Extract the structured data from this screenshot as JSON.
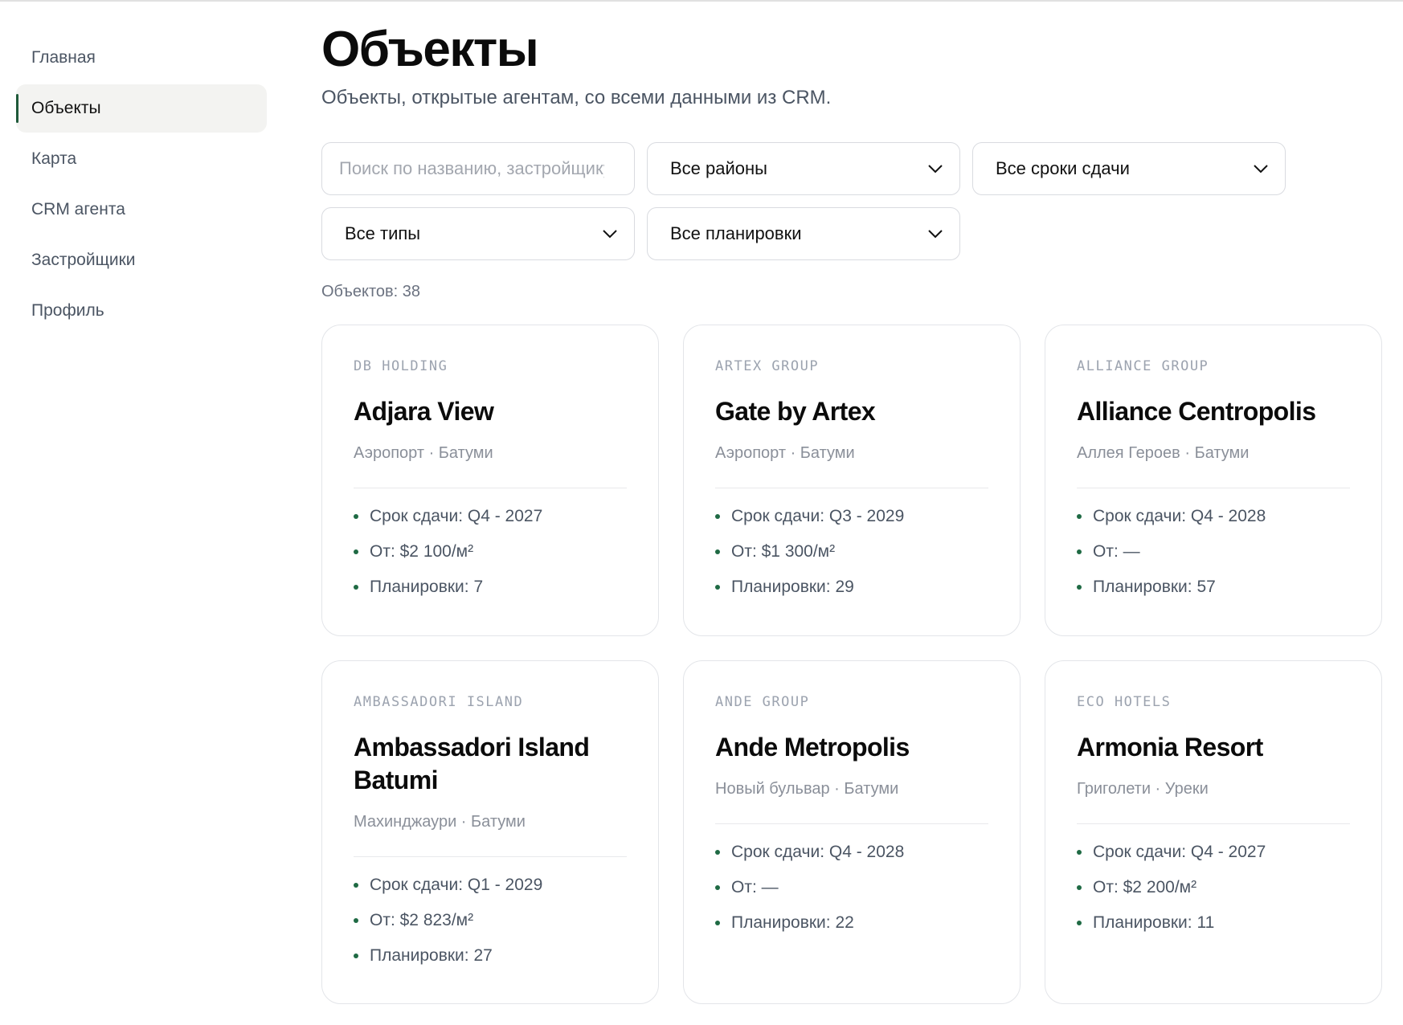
{
  "sidebar": {
    "items": [
      {
        "label": "Главная",
        "active": false
      },
      {
        "label": "Объекты",
        "active": true
      },
      {
        "label": "Карта",
        "active": false
      },
      {
        "label": "CRM агента",
        "active": false
      },
      {
        "label": "Застройщики",
        "active": false
      },
      {
        "label": "Профиль",
        "active": false
      }
    ]
  },
  "page": {
    "title": "Объекты",
    "subtitle": "Объекты, открытые агентам, со всеми данными из CRM."
  },
  "filters": {
    "search_placeholder": "Поиск по названию, застройщику",
    "district": "Все районы",
    "deadline": "Все сроки сдачи",
    "type": "Все типы",
    "layout": "Все планировки"
  },
  "count_label": "Объектов: 38",
  "accent_color": "#1f5a3a",
  "cards": [
    {
      "developer": "DB HOLDING",
      "name": "Adjara View",
      "location": "Аэропорт · Батуми",
      "facts": [
        "Срок сдачи: Q4 - 2027",
        "От: $2 100/м²",
        "Планировки: 7"
      ]
    },
    {
      "developer": "ARTEX GROUP",
      "name": "Gate by Artex",
      "location": "Аэропорт · Батуми",
      "facts": [
        "Срок сдачи: Q3 - 2029",
        "От: $1 300/м²",
        "Планировки: 29"
      ]
    },
    {
      "developer": "ALLIANCE GROUP",
      "name": "Alliance Centropolis",
      "location": "Аллея Героев · Батуми",
      "facts": [
        "Срок сдачи: Q4 - 2028",
        "От: —",
        "Планировки: 57"
      ]
    },
    {
      "developer": "AMBASSADORI ISLAND",
      "name": "Ambassadori Island Batumi",
      "location": "Махинджаури · Батуми",
      "facts": [
        "Срок сдачи: Q1 - 2029",
        "От: $2 823/м²",
        "Планировки: 27"
      ]
    },
    {
      "developer": "ANDE GROUP",
      "name": "Ande Metropolis",
      "location": "Новый бульвар · Батуми",
      "facts": [
        "Срок сдачи: Q4 - 2028",
        "От: —",
        "Планировки: 22"
      ]
    },
    {
      "developer": "ECO HOTELS",
      "name": "Armonia Resort",
      "location": "Григолети · Уреки",
      "facts": [
        "Срок сдачи: Q4 - 2027",
        "От: $2 200/м²",
        "Планировки: 11"
      ]
    }
  ]
}
